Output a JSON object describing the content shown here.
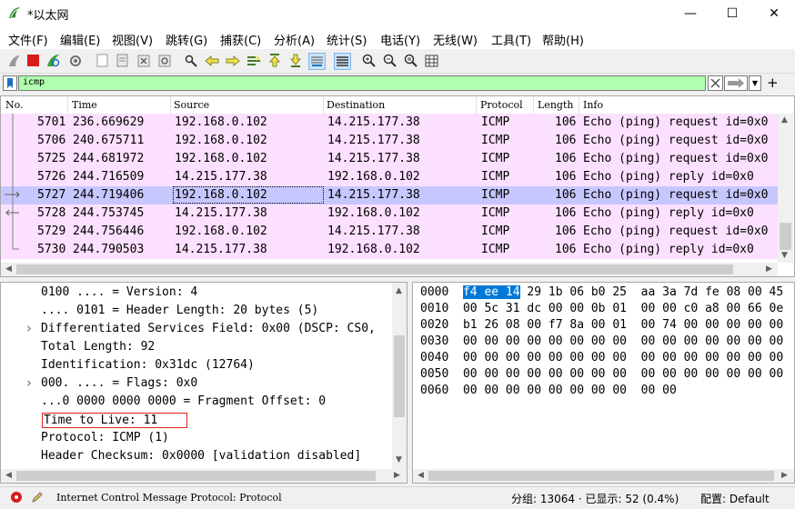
{
  "window": {
    "title": "*以太网",
    "minimize": "—",
    "maximize": "☐",
    "close": "✕"
  },
  "menu": [
    "文件(F)",
    "编辑(E)",
    "视图(V)",
    "跳转(G)",
    "捕获(C)",
    "分析(A)",
    "统计(S)",
    "电话(Y)",
    "无线(W)",
    "工具(T)",
    "帮助(H)"
  ],
  "filter": {
    "value": "icmp"
  },
  "columns": [
    "No.",
    "Time",
    "Source",
    "Destination",
    "Protocol",
    "Length",
    "Info"
  ],
  "packets": [
    {
      "no": "5701",
      "time": "236.669629",
      "src": "192.168.0.102",
      "dst": "14.215.177.38",
      "proto": "ICMP",
      "len": "106",
      "info": "Echo (ping) request  id=0x0"
    },
    {
      "no": "5706",
      "time": "240.675711",
      "src": "192.168.0.102",
      "dst": "14.215.177.38",
      "proto": "ICMP",
      "len": "106",
      "info": "Echo (ping) request  id=0x0"
    },
    {
      "no": "5725",
      "time": "244.681972",
      "src": "192.168.0.102",
      "dst": "14.215.177.38",
      "proto": "ICMP",
      "len": "106",
      "info": "Echo (ping) request  id=0x0"
    },
    {
      "no": "5726",
      "time": "244.716509",
      "src": "14.215.177.38",
      "dst": "192.168.0.102",
      "proto": "ICMP",
      "len": "106",
      "info": "Echo (ping) reply    id=0x0"
    },
    {
      "no": "5727",
      "time": "244.719406",
      "src": "192.168.0.102",
      "dst": "14.215.177.38",
      "proto": "ICMP",
      "len": "106",
      "info": "Echo (ping) request  id=0x0"
    },
    {
      "no": "5728",
      "time": "244.753745",
      "src": "14.215.177.38",
      "dst": "192.168.0.102",
      "proto": "ICMP",
      "len": "106",
      "info": "Echo (ping) reply    id=0x0"
    },
    {
      "no": "5729",
      "time": "244.756446",
      "src": "192.168.0.102",
      "dst": "14.215.177.38",
      "proto": "ICMP",
      "len": "106",
      "info": "Echo (ping) request  id=0x0"
    },
    {
      "no": "5730",
      "time": "244.790503",
      "src": "14.215.177.38",
      "dst": "192.168.0.102",
      "proto": "ICMP",
      "len": "106",
      "info": "Echo (ping) reply    id=0x0"
    }
  ],
  "selected_packet_index": 4,
  "details": [
    {
      "text": "0100 .... = Version: 4",
      "expandable": false
    },
    {
      "text": ".... 0101 = Header Length: 20 bytes (5)",
      "expandable": false
    },
    {
      "text": "Differentiated Services Field: 0x00 (DSCP: CS0,",
      "expandable": true
    },
    {
      "text": "Total Length: 92",
      "expandable": false
    },
    {
      "text": "Identification: 0x31dc (12764)",
      "expandable": false
    },
    {
      "text": "000. .... = Flags: 0x0",
      "expandable": true
    },
    {
      "text": "...0 0000 0000 0000 = Fragment Offset: 0",
      "expandable": false
    },
    {
      "text": "Time to Live: 11",
      "expandable": false,
      "boxed": true
    },
    {
      "text": "Protocol: ICMP (1)",
      "expandable": false
    },
    {
      "text": "Header Checksum: 0x0000 [validation disabled]",
      "expandable": false
    }
  ],
  "bytes": [
    {
      "offset": "0000",
      "hl": "f4 ee 14",
      "rest": " 29 1b 06 b0 25  aa 3a 7d fe 08 00 45"
    },
    {
      "offset": "0010",
      "hl": "",
      "rest": "00 5c 31 dc 00 00 0b 01  00 00 c0 a8 00 66 0e"
    },
    {
      "offset": "0020",
      "hl": "",
      "rest": "b1 26 08 00 f7 8a 00 01  00 74 00 00 00 00 00"
    },
    {
      "offset": "0030",
      "hl": "",
      "rest": "00 00 00 00 00 00 00 00  00 00 00 00 00 00 00"
    },
    {
      "offset": "0040",
      "hl": "",
      "rest": "00 00 00 00 00 00 00 00  00 00 00 00 00 00 00"
    },
    {
      "offset": "0050",
      "hl": "",
      "rest": "00 00 00 00 00 00 00 00  00 00 00 00 00 00 00"
    },
    {
      "offset": "0060",
      "hl": "",
      "rest": "00 00 00 00 00 00 00 00  00 00"
    }
  ],
  "status": {
    "protocol": "Internet Control Message Protocol: Protocol",
    "packets": "分组: 13064 · 已显示: 52 (0.4%)",
    "profile": "配置: Default"
  },
  "colors": {
    "row_bg": "#fce0ff",
    "row_selected": "#c7c7ff",
    "filter_ok": "#afffaf",
    "byte_highlight": "#0078d7"
  }
}
